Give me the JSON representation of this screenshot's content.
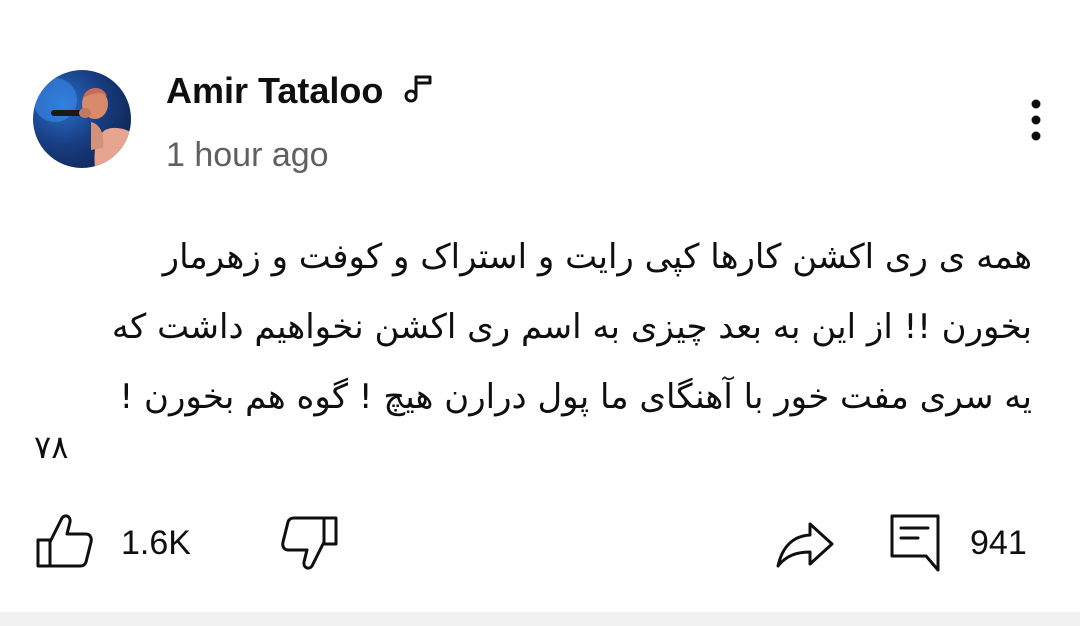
{
  "post": {
    "author_name": "Amir Tataloo",
    "timestamp": "1 hour ago",
    "body_lines": [
      "همه ی ری اکشن کارها کپی رایت و استراک و کوفت و زهرمار",
      "بخورن !! از این به بعد چیزی به اسم ری اکشن نخواهیم داشت که",
      "یه سری مفت خور با آهنگای ما پول درارن هیچ ! گوه هم بخورن !",
      "۷۸"
    ],
    "actions": {
      "like_count": "1.6K",
      "comment_count": "941"
    }
  },
  "icons": {
    "avatar": "avatar-photo",
    "music": "music-note-icon",
    "more": "more-vertical-icon",
    "like": "thumbs-up-icon",
    "dislike": "thumbs-down-icon",
    "share": "share-arrow-icon",
    "comment": "comment-icon"
  },
  "colors": {
    "text": "#0f0f0f",
    "secondary_text": "#606060",
    "divider": "#f1f1f1"
  }
}
